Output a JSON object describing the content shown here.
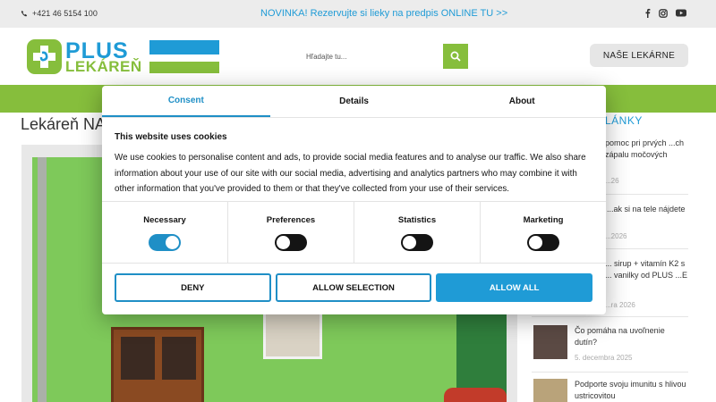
{
  "topbar": {
    "phone": "+421 46 5154 100",
    "promo": "NOVINKA! Rezervujte si lieky na predpis ONLINE TU >>",
    "social_icons": [
      "facebook-icon",
      "instagram-icon",
      "youtube-icon"
    ]
  },
  "header": {
    "logo_line1": "PLUS",
    "logo_line2": "LEKÁREŇ",
    "search_placeholder": "Hľadajte tu...",
    "pharmacies_button": "NAŠE LEKÁRNE"
  },
  "page": {
    "title": "Lekáreň NA"
  },
  "sidebar": {
    "heading": "LÁNKY",
    "items": [
      {
        "title": "pomoc pri prvých ...ch zápalu močových",
        "date": "...26"
      },
      {
        "title": "...ak si na tele nájdete",
        "date": "...2026"
      },
      {
        "title": "... sirup + vitamín K2 s ... vanilky od PLUS ...E",
        "date": "...ra 2026"
      },
      {
        "title": "Čo pomáha na uvoľnenie dutín?",
        "date": "5. decembra 2025"
      },
      {
        "title": "Podporte svoju imunitu s hlivou ustricovitou",
        "date": ""
      }
    ]
  },
  "cookie_dialog": {
    "tabs": [
      "Consent",
      "Details",
      "About"
    ],
    "active_tab": "Consent",
    "heading": "This website uses cookies",
    "text": "We use cookies to personalise content and ads, to provide social media features and to analyse our traffic. We also share information about your use of our site with our social media, advertising and analytics partners who may combine it with other information that you've provided to them or that they've collected from your use of their services.",
    "toggles": [
      {
        "label": "Necessary",
        "on": true
      },
      {
        "label": "Preferences",
        "on": false
      },
      {
        "label": "Statistics",
        "on": false
      },
      {
        "label": "Marketing",
        "on": false
      }
    ],
    "buttons": {
      "deny": "DENY",
      "allow_selection": "ALLOW SELECTION",
      "allow_all": "ALLOW ALL"
    }
  },
  "colors": {
    "brand_blue": "#1f9bd6",
    "brand_green": "#86be3c",
    "accent_blue": "#1f8fc6"
  }
}
